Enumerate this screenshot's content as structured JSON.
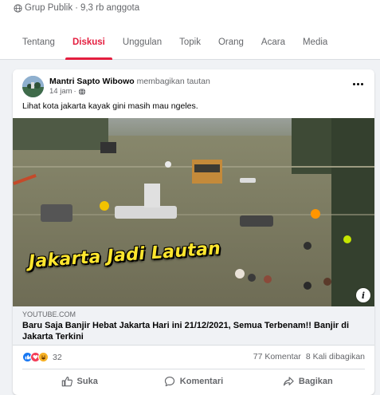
{
  "group": {
    "privacy": "Grup Publik",
    "members": "9,3 rb anggota"
  },
  "tabs": [
    {
      "label": "Tentang",
      "active": false
    },
    {
      "label": "Diskusi",
      "active": true
    },
    {
      "label": "Unggulan",
      "active": false
    },
    {
      "label": "Topik",
      "active": false
    },
    {
      "label": "Orang",
      "active": false
    },
    {
      "label": "Acara",
      "active": false
    },
    {
      "label": "Media",
      "active": false
    }
  ],
  "post": {
    "author": "Mantri Sapto Wibowo",
    "action": "membagikan tautan",
    "time": "14 jam",
    "separator": "·",
    "text": "Lihat kota jakarta kayak gini masih mau ngeles.",
    "link": {
      "image_overlay_text": "Jakarta Jadi Lautan",
      "info_icon": "i",
      "domain": "YOUTUBE.COM",
      "title": "Baru Saja Banjir Hebat Jakarta Hari ini 21/12/2021, Semua Terbenam!! Banjir di Jakarta Terkini"
    },
    "reactions": {
      "icons": [
        "like-icon",
        "love-icon",
        "haha-icon"
      ],
      "count": "32"
    },
    "comments": "77 Komentar",
    "shares": "8 Kali dibagikan",
    "buttons": {
      "like": "Suka",
      "comment": "Komentari",
      "share": "Bagikan"
    }
  },
  "colors": {
    "active_tab": "#e41e3f",
    "link_bg": "#f0f2f5",
    "like_blue": "#1877f2",
    "overlay_yellow": "#ffe62e"
  }
}
